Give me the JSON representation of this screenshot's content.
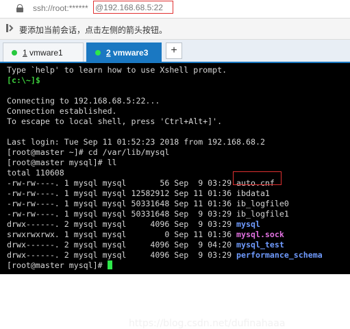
{
  "address_bar": {
    "text": "ssh://root:******",
    "host": "@192.168.68.5:22"
  },
  "hint_bar": {
    "text": "要添加当前会话，点击左侧的箭头按钮。"
  },
  "tabs": [
    {
      "num": "1",
      "name": "vmware1",
      "active": false
    },
    {
      "num": "2",
      "name": "vmware3",
      "active": true
    }
  ],
  "new_tab_label": "+",
  "terminal": {
    "lines": [
      "Type `help' to learn how to use Xshell prompt.",
      "[c:\\~]$",
      "",
      "Connecting to 192.168.68.5:22...",
      "Connection established.",
      "To escape to local shell, press 'Ctrl+Alt+]'.",
      "",
      "Last login: Tue Sep 11 01:52:23 2018 from 192.168.68.2",
      "[root@master ~]# cd /var/lib/mysql",
      "[root@master mysql]# ll",
      "total 110608"
    ],
    "listing": [
      {
        "prefix": "-rw-rw----. 1 mysql mysql       56 Sep  9 03:29 ",
        "name": "auto.cnf",
        "style": "plain"
      },
      {
        "prefix": "-rw-rw----. 1 mysql mysql 12582912 Sep 11 01:36 ",
        "name": "ibdata1",
        "style": "plain"
      },
      {
        "prefix": "-rw-rw----. 1 mysql mysql 50331648 Sep 11 01:36 ",
        "name": "ib_logfile0",
        "style": "plain"
      },
      {
        "prefix": "-rw-rw----. 1 mysql mysql 50331648 Sep  9 03:29 ",
        "name": "ib_logfile1",
        "style": "plain"
      },
      {
        "prefix": "drwx------. 2 mysql mysql     4096 Sep  9 03:29 ",
        "name": "mysql",
        "style": "dir"
      },
      {
        "prefix": "srwxrwxrwx. 1 mysql mysql        0 Sep 11 01:36 ",
        "name": "mysql.sock",
        "style": "sock"
      },
      {
        "prefix": "drwx------. 2 mysql mysql     4096 Sep  9 04:20 ",
        "name": "mysql_test",
        "style": "dir"
      },
      {
        "prefix": "drwx------. 2 mysql mysql     4096 Sep  9 03:29 ",
        "name": "performance_schema",
        "style": "dir"
      }
    ],
    "prompt": "[root@master mysql]# "
  },
  "watermark": "https://blog.csdn.net/dufinahaaa",
  "colors": {
    "accent": "#1a78c2",
    "highlight_box": "#e03030",
    "terminal_bg": "#000000",
    "prompt_green": "#3ccc3c"
  }
}
